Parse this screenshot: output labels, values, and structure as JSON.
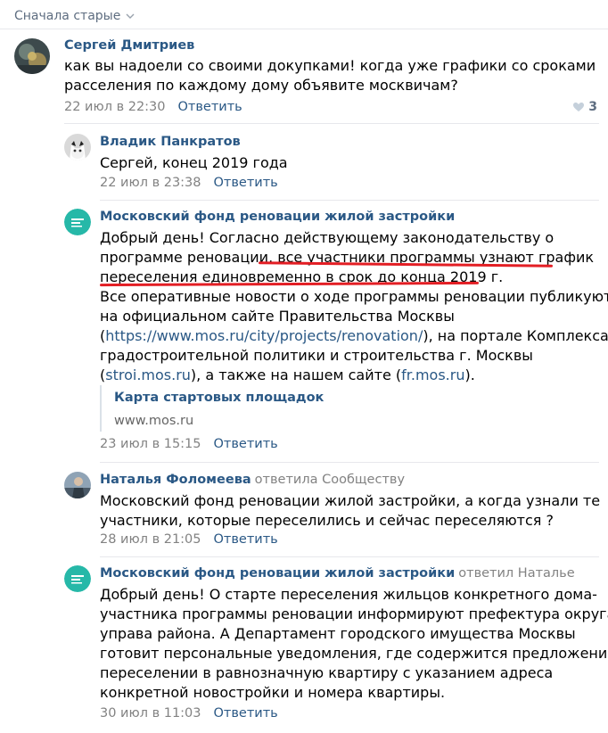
{
  "sort": {
    "label": "Сначала старые",
    "icon": "chevron-down-icon"
  },
  "reply_label": "Ответить",
  "comments": [
    {
      "author": "Сергей Дмитриев",
      "text": [
        "как вы надоели со своими докупками! когда уже графики со сроками",
        "расселения по каждому дому объявите москвичам?"
      ],
      "date": "22 июл в 22:30",
      "likes": "3"
    },
    {
      "author": "Владик Панкратов",
      "text": [
        "Сергей, конец 2019 года"
      ],
      "date": "22 июл в 23:38"
    },
    {
      "author": "Московский фонд реновации жилой застройки",
      "text_a": [
        "Добрый день! Согласно действующему законодательству о",
        "программе реновации, все участники программы узнают график",
        "переселения единовременно в срок до конца 2019 г.",
        "Все оперативные новости о ходе программы реновации публикуются",
        "на официальном сайте Правительства Москвы"
      ],
      "line6": {
        "pre": "(",
        "link": "https://www.mos.ru/city/projects/renovation/",
        "post": "), на портале Комплекса"
      },
      "line7": "градостроительной политики и строительства г. Москвы",
      "line8": {
        "pre": "(",
        "link1": "stroi.mos.ru",
        "mid": "), а также на нашем сайте (",
        "link2": "fr.mos.ru",
        "post": ")."
      },
      "attachment": {
        "title": "Карта стартовых площадок",
        "domain": "www.mos.ru"
      },
      "date": "23 июл в 15:15"
    },
    {
      "author": "Наталья Фоломеева",
      "reply_to": "ответила Сообществу",
      "text": [
        "Московский фонд реновации жилой застройки, а когда узнали те",
        "участники, которые переселились и сейчас переселяются ?"
      ],
      "date": "28 июл в 21:05"
    },
    {
      "author": "Московский фонд реновации жилой застройки",
      "reply_to": "ответил Наталье",
      "text": [
        "Добрый день! О старте переселения жильцов конкретного дома-",
        "участника программы реновации информируют префектура округа и",
        "управа района. А Департамент городского имущества Москвы",
        "готовит персональные уведомления, где содержится предложение о",
        "переселении в равнозначную квартиру с указанием адреса",
        "конкретной новостройки и номера квартиры."
      ],
      "date": "30 июл в 11:03"
    }
  ],
  "colors": {
    "link": "#2a5885",
    "muted": "#828282",
    "underline": "#e31e24",
    "divider": "#e7e8ec"
  }
}
